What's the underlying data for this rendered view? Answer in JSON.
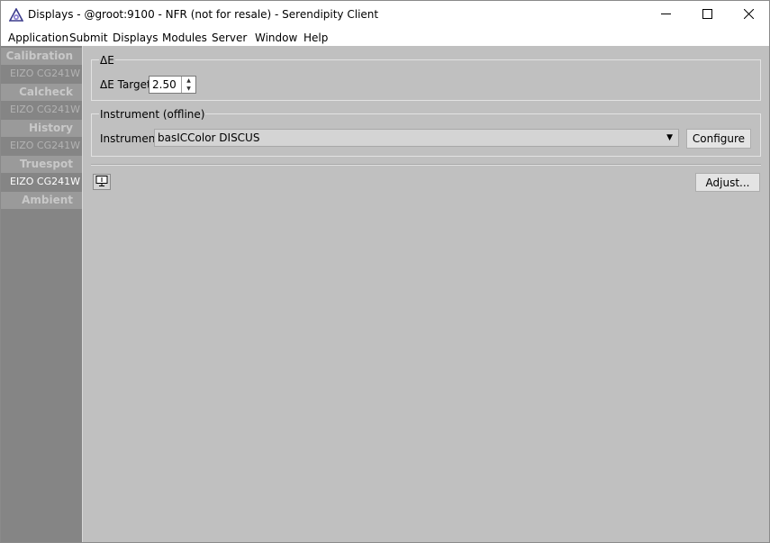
{
  "window": {
    "title": "Displays - @groot:9100 - NFR (not for resale) - Serendipity Client",
    "app_icon": "serendipity-logo-icon",
    "controls": [
      "minimize-icon",
      "maximize-icon",
      "close-icon"
    ]
  },
  "menubar": {
    "items": [
      "Application",
      "Submit",
      "Displays",
      "Modules",
      "Server",
      "Window",
      "Help"
    ]
  },
  "sidebar": {
    "sections": [
      {
        "header": "Calibration",
        "item": "EIZO CG241W"
      },
      {
        "header": "Calcheck",
        "item": "EIZO CG241W"
      },
      {
        "header": "History",
        "item": "EIZO CG241W"
      },
      {
        "header": "Truespot",
        "item": "EIZO CG241W"
      },
      {
        "header": "Ambient"
      }
    ],
    "active_item": "EIZO CG241W"
  },
  "delta_e": {
    "group_label": "ΔE",
    "target_label": "ΔE Target",
    "target_value": "2.50"
  },
  "instrument": {
    "group_label": "Instrument (offline)",
    "label": "Instrument",
    "selected": "basICColor DISCUS",
    "configure_label": "Configure"
  },
  "footer": {
    "display_icon": "display-info-icon",
    "adjust_label": "Adjust..."
  },
  "colors": {
    "sidebar_bg": "#858585",
    "sidebar_header_bg": "#9a9a9a",
    "content_bg": "#c0c0c0"
  }
}
